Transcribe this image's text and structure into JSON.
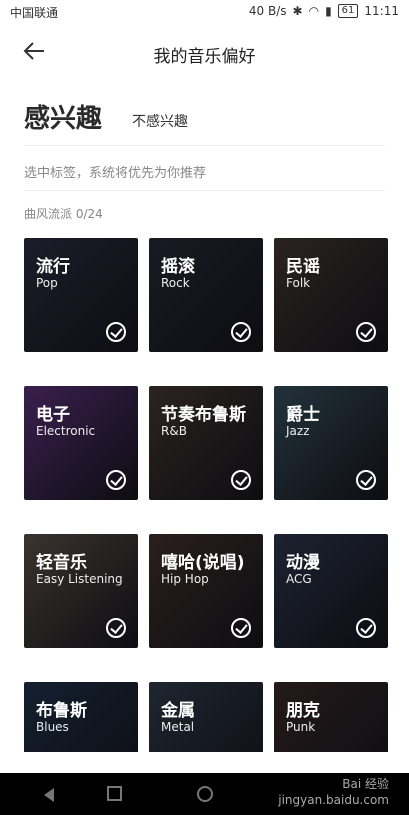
{
  "status_bar": {
    "carrier": "中国联通",
    "speed": "40 B/s",
    "battery": "61",
    "time": "11:11"
  },
  "header": {
    "title": "我的音乐偏好"
  },
  "tabs": [
    {
      "label": "感兴趣",
      "active": true
    },
    {
      "label": "不感兴趣",
      "active": false
    }
  ],
  "hint": "选中标签，系统将优先为你推荐",
  "section": {
    "label": "曲风流派",
    "count": "0/24"
  },
  "genres": [
    {
      "cn": "流行",
      "en": "Pop",
      "bg": "#1d1d2a"
    },
    {
      "cn": "摇滚",
      "en": "Rock",
      "bg": "#1a1a24"
    },
    {
      "cn": "民谣",
      "en": "Folk",
      "bg": "#2a2320"
    },
    {
      "cn": "电子",
      "en": "Electronic",
      "bg": "#3a1f4e"
    },
    {
      "cn": "节奏布鲁斯",
      "en": "R&B",
      "bg": "#2b2320"
    },
    {
      "cn": "爵士",
      "en": "Jazz",
      "bg": "#22323a"
    },
    {
      "cn": "轻音乐",
      "en": "Easy Listening",
      "bg": "#3a332e"
    },
    {
      "cn": "嘻哈(说唱)",
      "en": "Hip Hop",
      "bg": "#2a1f1d"
    },
    {
      "cn": "动漫",
      "en": "ACG",
      "bg": "#1c2230"
    },
    {
      "cn": "布鲁斯",
      "en": "Blues",
      "bg": "#142030"
    },
    {
      "cn": "金属",
      "en": "Metal",
      "bg": "#1e2630"
    },
    {
      "cn": "朋克",
      "en": "Punk",
      "bg": "#241a1a"
    }
  ],
  "watermark": {
    "line1": "Bai 经验",
    "line2": "jingyan.baidu.com"
  }
}
